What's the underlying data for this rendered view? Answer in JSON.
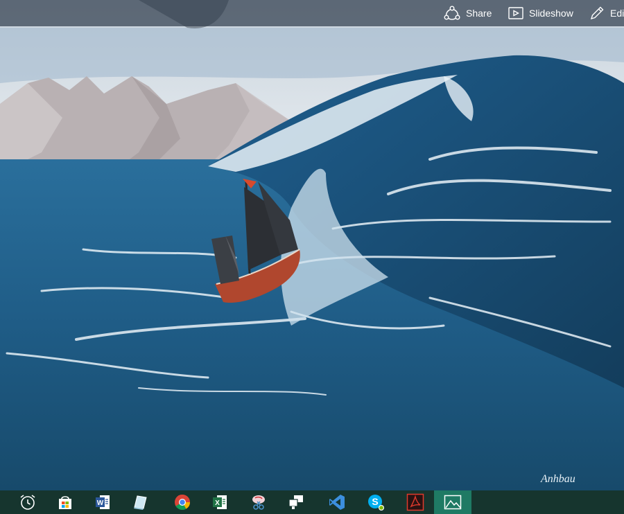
{
  "window": {
    "title": "Photos"
  },
  "toolbar": {
    "share_label": "Share",
    "slideshow_label": "Slideshow",
    "edit_label": "Edi"
  },
  "painting": {
    "subject": "ship on stormy sea oil painting",
    "signature": "Anhbau",
    "colors": {
      "sky": "#dfe4ea",
      "mountain": "#b9b1b3",
      "sea_dark": "#1c4d72",
      "sea_mid": "#2a6f9c",
      "foam": "#e8f1f7",
      "hull": "#b0472e",
      "sails": "#2c2f34",
      "flag": "#d84a2c"
    }
  },
  "taskbar": {
    "items": [
      {
        "icon": "alarm-clock-icon",
        "active": false
      },
      {
        "icon": "store-icon",
        "active": false
      },
      {
        "icon": "word-icon",
        "active": false
      },
      {
        "icon": "notes-icon",
        "active": false
      },
      {
        "icon": "chrome-icon",
        "active": false
      },
      {
        "icon": "excel-icon",
        "active": false
      },
      {
        "icon": "snipping-tool-icon",
        "active": false
      },
      {
        "icon": "remote-desktop-icon",
        "active": false
      },
      {
        "icon": "visual-studio-icon",
        "active": false
      },
      {
        "icon": "skype-icon",
        "active": false
      },
      {
        "icon": "acrobat-icon",
        "active": false
      },
      {
        "icon": "photos-icon",
        "active": true
      }
    ]
  }
}
